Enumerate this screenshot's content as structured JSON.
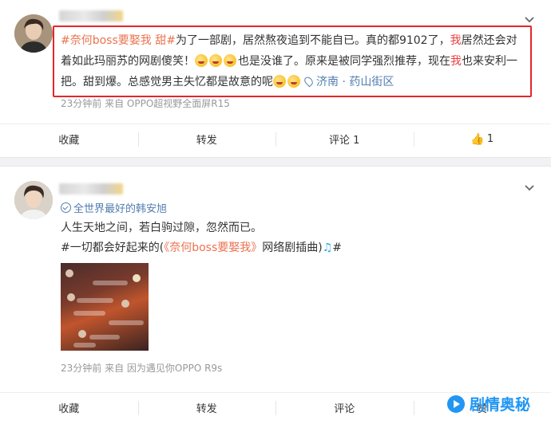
{
  "posts": [
    {
      "text_parts": {
        "tag": "#奈何boss要娶我 甜#",
        "p1": "为了一部剧，居然熬夜追到不能自已。真的都9102了，",
        "hl1": "我",
        "p2": "居然还会对着如此玛丽苏的网剧傻笑！",
        "p3": "也是没谁了。原来是被同学强烈推荐，现在",
        "hl2": "我",
        "p4": "也来安利一把。甜到爆。总感觉男主失忆都是故意的呢",
        "location": "济南 · 药山街区"
      },
      "meta": "23分钟前 来自 OPPO超视野全面屏R15",
      "actions": {
        "favorite": "收藏",
        "repost": "转发",
        "comment": "评论 1",
        "like": "1"
      }
    },
    {
      "badge": "全世界最好的韩安旭",
      "line1": "人生天地之间，若白驹过隙，忽然而已。",
      "line2_parts": {
        "pre": "#一切都会好起来的(",
        "title": "《奈何boss要娶我》",
        "post": "网络剧插曲)"
      },
      "line2_end": "#",
      "meta": "23分钟前 来自 因为遇见你OPPO R9s",
      "actions": {
        "favorite": "收藏",
        "repost": "转发",
        "comment": "评论",
        "like": "赞"
      }
    }
  ],
  "watermark": "剧情奥秘",
  "icons": [
    "chevron-down-icon",
    "location-icon",
    "laugh-emoji-icon",
    "flushed-emoji-icon",
    "verified-icon",
    "music-icon",
    "like-icon",
    "watermark-play-icon"
  ],
  "colors": {
    "tag": "#eb7350",
    "highlight": "#eb3e3e",
    "link": "#507daf",
    "box": "#e5262a",
    "watermark": "#2196f3"
  }
}
